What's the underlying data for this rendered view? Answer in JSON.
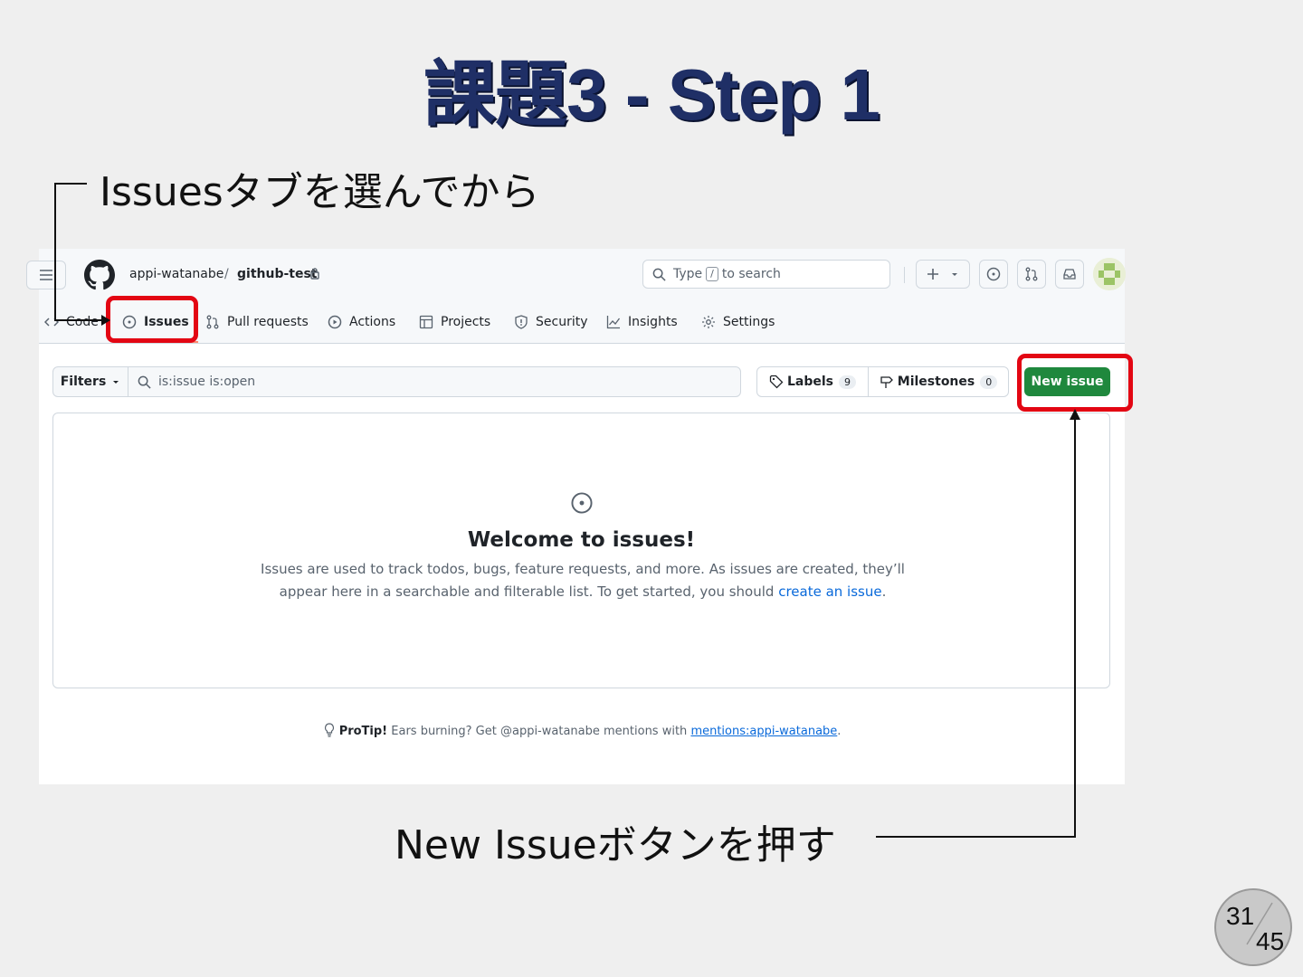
{
  "slide": {
    "title": "課題3 - Step 1",
    "note_top": "Issuesタブを選んでから",
    "note_bottom": "New Issueボタンを押す",
    "page_current": "31",
    "page_total": "45"
  },
  "header": {
    "owner": "appi-watanabe",
    "separator": "/",
    "repo": "github-test",
    "search_prefix": "Type",
    "search_key": "/",
    "search_suffix": "to search"
  },
  "tabs": [
    {
      "label": "Code"
    },
    {
      "label": "Issues"
    },
    {
      "label": "Pull requests"
    },
    {
      "label": "Actions"
    },
    {
      "label": "Projects"
    },
    {
      "label": "Security"
    },
    {
      "label": "Insights"
    },
    {
      "label": "Settings"
    }
  ],
  "toolbar": {
    "filters_label": "Filters",
    "filter_query": "is:issue is:open",
    "labels_label": "Labels",
    "labels_count": "9",
    "milestones_label": "Milestones",
    "milestones_count": "0",
    "new_issue_label": "New issue"
  },
  "empty_state": {
    "title": "Welcome to issues!",
    "desc_line1": "Issues are used to track todos, bugs, feature requests, and more. As issues are created, they’ll",
    "desc_line2": "appear here in a searchable and filterable list. To get started, you should",
    "desc_link": "create an issue",
    "desc_end": "."
  },
  "protip": {
    "label": "ProTip!",
    "text": "Ears burning? Get @appi-watanabe mentions with",
    "link": "mentions:appi-watanabe",
    "end": "."
  },
  "colors": {
    "title": "#1f2f66",
    "highlight": "#e30613",
    "primary_button": "#1f883d",
    "link": "#0969da"
  }
}
